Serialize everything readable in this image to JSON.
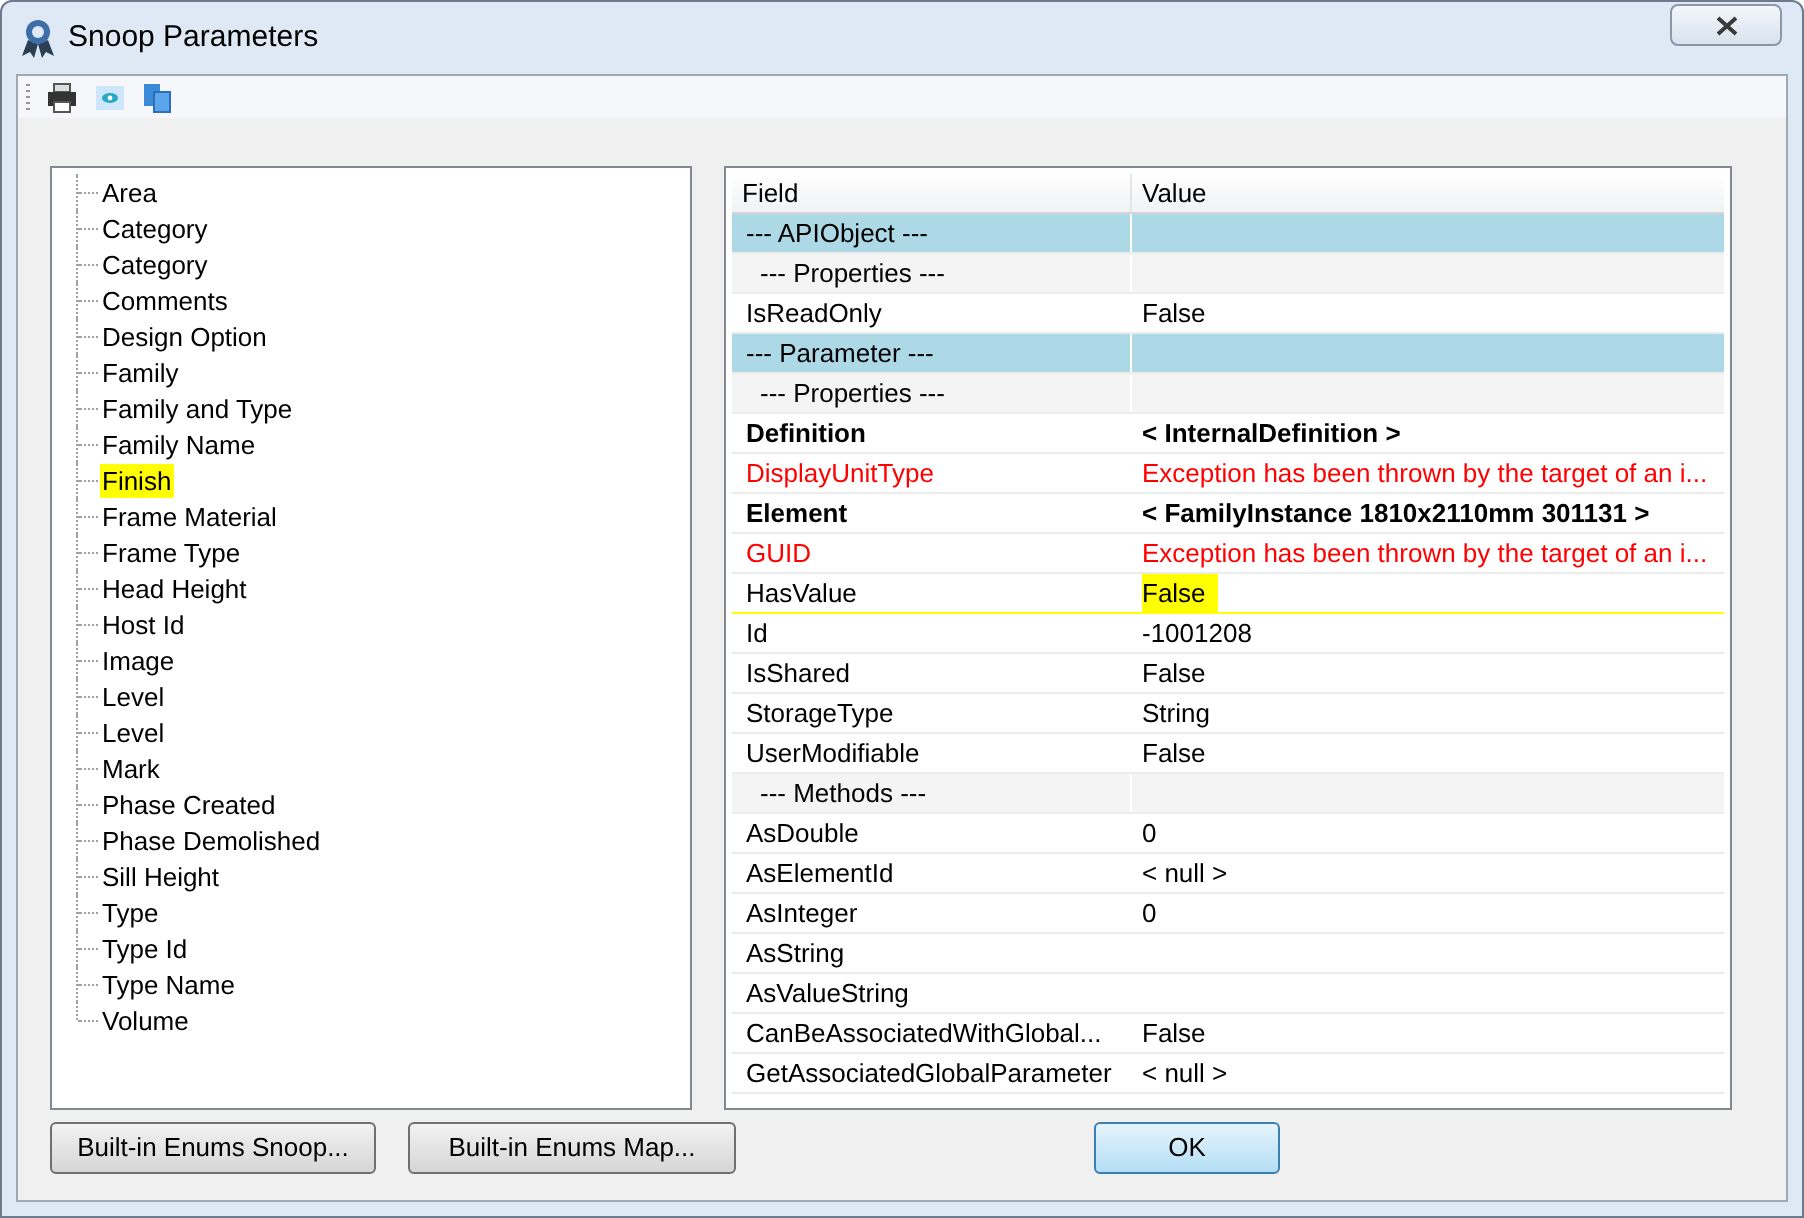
{
  "window": {
    "title": "Snoop Parameters"
  },
  "tree": {
    "items": [
      {
        "label": "Area",
        "highlighted": false
      },
      {
        "label": "Category",
        "highlighted": false
      },
      {
        "label": "Category",
        "highlighted": false
      },
      {
        "label": "Comments",
        "highlighted": false
      },
      {
        "label": "Design Option",
        "highlighted": false
      },
      {
        "label": "Family",
        "highlighted": false
      },
      {
        "label": "Family and Type",
        "highlighted": false
      },
      {
        "label": "Family Name",
        "highlighted": false
      },
      {
        "label": "Finish",
        "highlighted": true
      },
      {
        "label": "Frame Material",
        "highlighted": false
      },
      {
        "label": "Frame Type",
        "highlighted": false
      },
      {
        "label": "Head Height",
        "highlighted": false
      },
      {
        "label": "Host Id",
        "highlighted": false
      },
      {
        "label": "Image",
        "highlighted": false
      },
      {
        "label": "Level",
        "highlighted": false
      },
      {
        "label": "Level",
        "highlighted": false
      },
      {
        "label": "Mark",
        "highlighted": false
      },
      {
        "label": "Phase Created",
        "highlighted": false
      },
      {
        "label": "Phase Demolished",
        "highlighted": false
      },
      {
        "label": "Sill Height",
        "highlighted": false
      },
      {
        "label": "Type",
        "highlighted": false
      },
      {
        "label": "Type Id",
        "highlighted": false
      },
      {
        "label": "Type Name",
        "highlighted": false
      },
      {
        "label": "Volume",
        "highlighted": false
      }
    ]
  },
  "table": {
    "columns": [
      "Field",
      "Value"
    ],
    "rows": [
      {
        "kind": "section",
        "field": "--- APIObject ---",
        "value": "",
        "highlighted": false
      },
      {
        "kind": "subsection",
        "field": "--- Properties ---",
        "value": "",
        "highlighted": false
      },
      {
        "kind": "normal",
        "field": "IsReadOnly",
        "value": "False",
        "highlighted": false
      },
      {
        "kind": "section",
        "field": "--- Parameter ---",
        "value": "",
        "highlighted": false
      },
      {
        "kind": "subsection",
        "field": "--- Properties ---",
        "value": "",
        "highlighted": false
      },
      {
        "kind": "bold",
        "field": "Definition",
        "value": "< InternalDefinition >",
        "highlighted": false
      },
      {
        "kind": "error",
        "field": "DisplayUnitType",
        "value": "Exception has been thrown by the target of an i...",
        "highlighted": false
      },
      {
        "kind": "bold",
        "field": "Element",
        "value": "< FamilyInstance  1810x2110mm  301131 >",
        "highlighted": false
      },
      {
        "kind": "error",
        "field": "GUID",
        "value": "Exception has been thrown by the target of an i...",
        "highlighted": false
      },
      {
        "kind": "normal",
        "field": "HasValue",
        "value": "False",
        "highlighted": true
      },
      {
        "kind": "normal",
        "field": "Id",
        "value": "-1001208",
        "highlighted": false
      },
      {
        "kind": "normal",
        "field": "IsShared",
        "value": "False",
        "highlighted": false
      },
      {
        "kind": "normal",
        "field": "StorageType",
        "value": "String",
        "highlighted": false
      },
      {
        "kind": "normal",
        "field": "UserModifiable",
        "value": "False",
        "highlighted": false
      },
      {
        "kind": "subsection",
        "field": "--- Methods ---",
        "value": "",
        "highlighted": false
      },
      {
        "kind": "normal",
        "field": "AsDouble",
        "value": "0",
        "highlighted": false
      },
      {
        "kind": "normal",
        "field": "AsElementId",
        "value": "< null >",
        "highlighted": false
      },
      {
        "kind": "normal",
        "field": "AsInteger",
        "value": "0",
        "highlighted": false
      },
      {
        "kind": "normal",
        "field": "AsString",
        "value": "",
        "highlighted": false
      },
      {
        "kind": "normal",
        "field": "AsValueString",
        "value": "",
        "highlighted": false
      },
      {
        "kind": "normal",
        "field": "CanBeAssociatedWithGlobal...",
        "value": "False",
        "highlighted": false
      },
      {
        "kind": "normal",
        "field": "GetAssociatedGlobalParameter",
        "value": "< null >",
        "highlighted": false
      }
    ]
  },
  "buttons": [
    {
      "label": "Built-in Enums Snoop...",
      "default": false
    },
    {
      "label": "Built-in Enums Map...",
      "default": false
    },
    {
      "label": "OK",
      "default": true
    }
  ]
}
